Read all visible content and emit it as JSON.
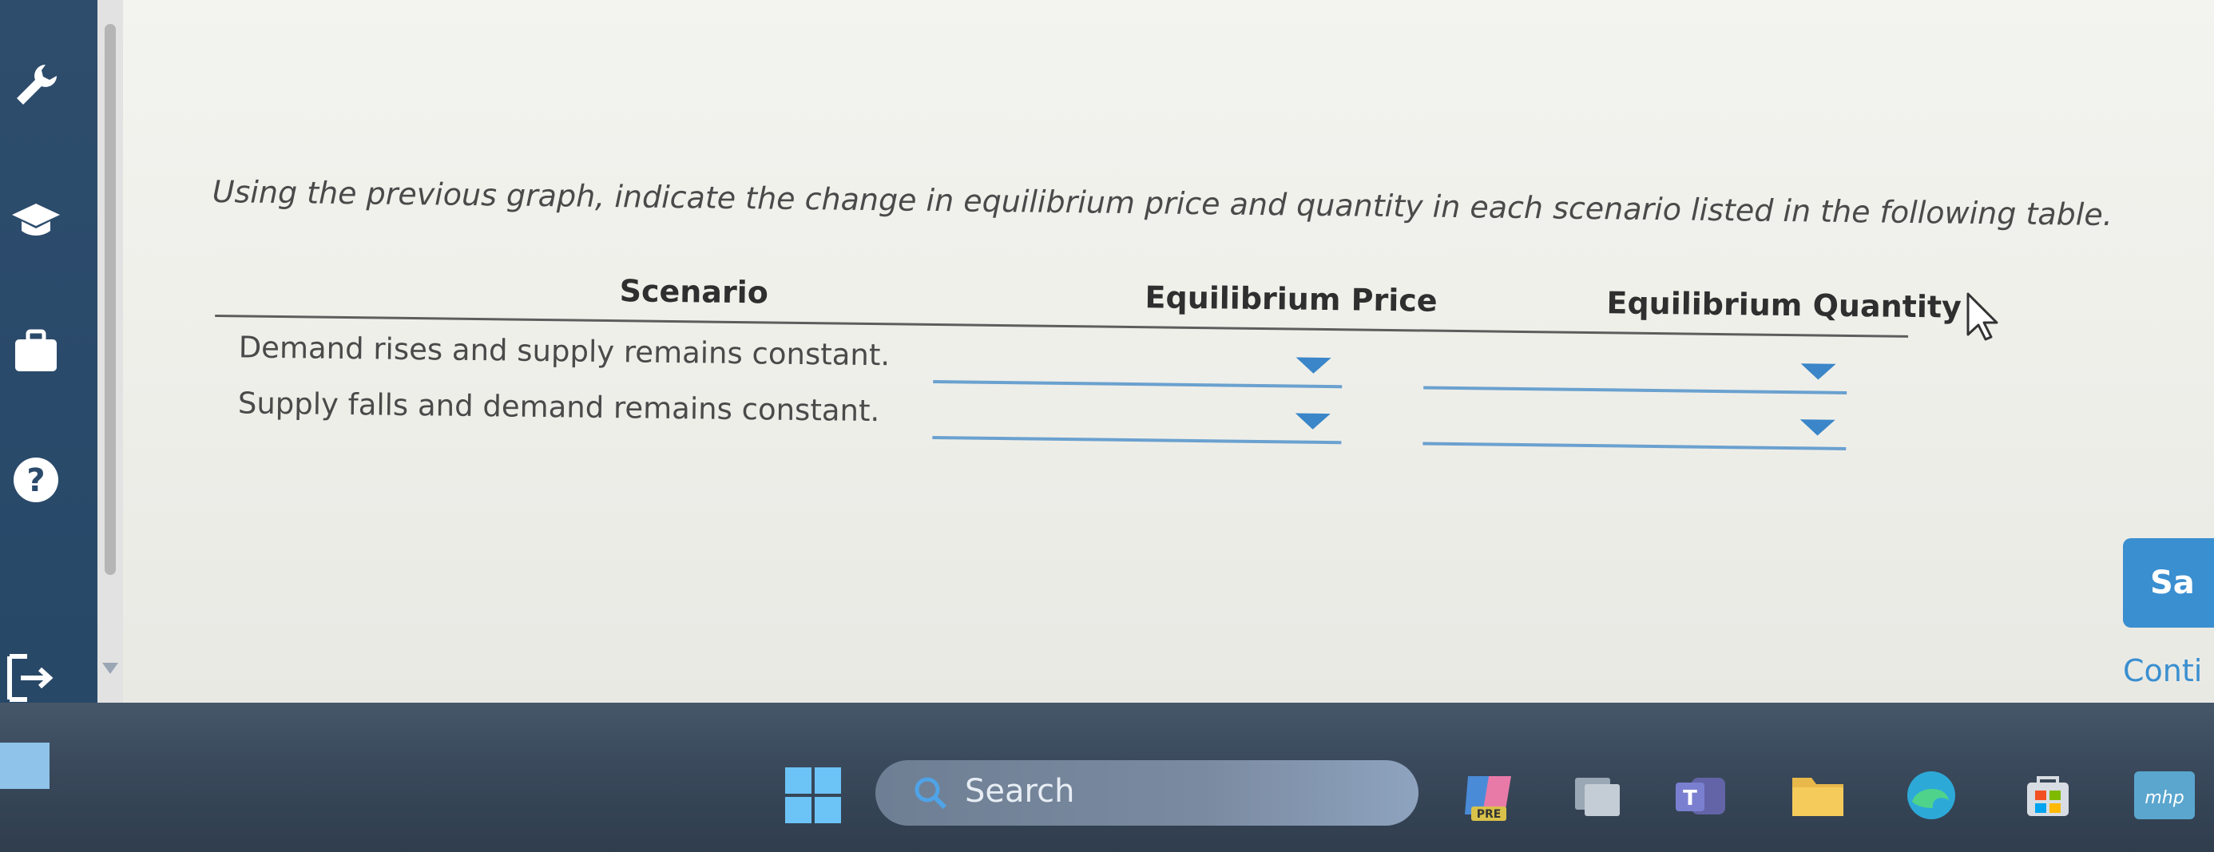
{
  "question": {
    "prompt": "Using the previous graph, indicate the change in equilibrium price and quantity in each scenario listed in the following table.",
    "columns": [
      "Scenario",
      "Equilibrium Price",
      "Equilibrium Quantity"
    ],
    "rows": [
      {
        "scenario": "Demand rises and supply remains constant.",
        "price": "",
        "quantity": ""
      },
      {
        "scenario": "Supply falls and demand remains constant.",
        "price": "",
        "quantity": ""
      }
    ]
  },
  "actions": {
    "save_label": "Sa",
    "continue_label": "Conti"
  },
  "taskbar": {
    "search_label": "Search",
    "pre_badge": "PRE",
    "mhp_label": "mhp"
  },
  "colors": {
    "accent": "#3a8fd0",
    "toolbar": "#2a4a6b",
    "dropdown_line": "#6aa1cf"
  }
}
